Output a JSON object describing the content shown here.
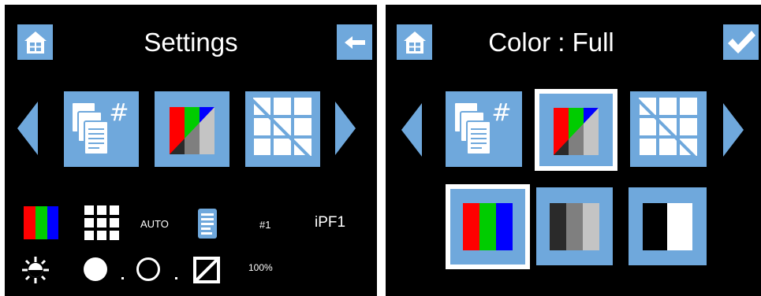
{
  "colors": {
    "accent": "#6fa8dc",
    "screen_bg": "#000000",
    "text": "#ffffff",
    "red": "#ff0000",
    "green": "#00cc00",
    "blue": "#0000ff"
  },
  "settings_screen": {
    "title": "Settings",
    "home_icon": "home-icon",
    "back_icon": "back-arrow-icon",
    "carousel": [
      "copies-icon",
      "color-mode-icon",
      "layout-icon"
    ],
    "status_row1": {
      "color_mode_icon": "rgb-color-icon",
      "layout_icon": "grid-icon",
      "auto_label": "AUTO",
      "document_icon": "document-icon",
      "copies_label": "#1",
      "printer_label": "iPF1"
    },
    "status_row2": {
      "brightness_icon": "brightness-icon",
      "zoom_label": "100%"
    }
  },
  "color_screen": {
    "title": "Color : Full",
    "home_icon": "home-icon",
    "confirm_icon": "checkmark-icon",
    "carousel": [
      "copies-icon",
      "color-mode-icon",
      "layout-icon"
    ],
    "selected_carousel_index": 1,
    "options": [
      {
        "name": "Full color",
        "icon": "full-color-icon"
      },
      {
        "name": "Grayscale",
        "icon": "grayscale-icon"
      },
      {
        "name": "Black and white",
        "icon": "black-white-icon"
      }
    ],
    "selected_option_index": 0
  }
}
